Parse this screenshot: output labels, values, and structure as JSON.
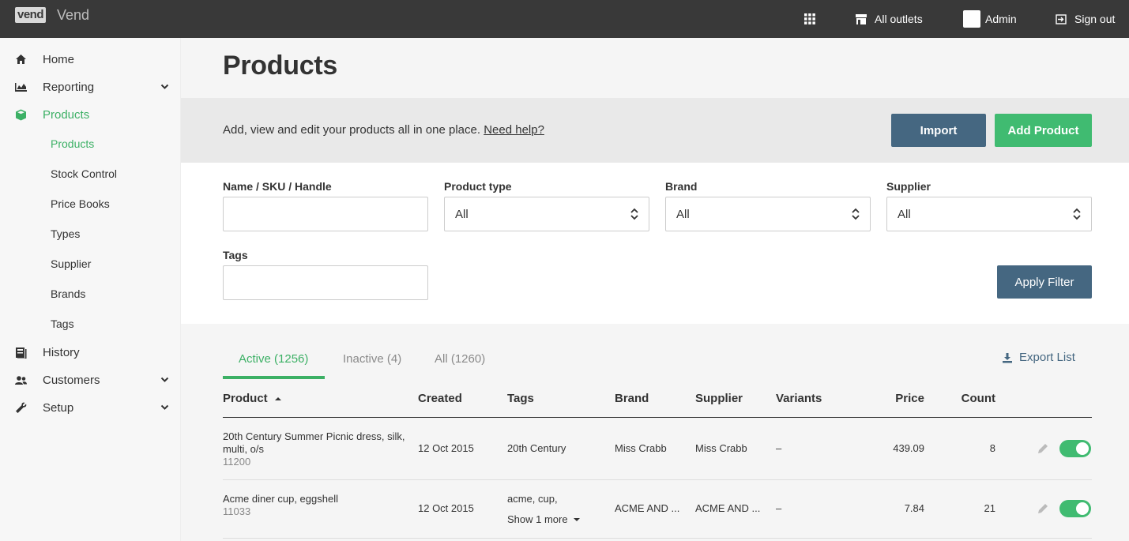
{
  "brand": {
    "logo_mark": "vend",
    "name": "Vend"
  },
  "topbar": {
    "apps_icon": "grid-icon",
    "outlets_label": "All outlets",
    "user_label": "Admin",
    "signout_label": "Sign out"
  },
  "sidebar": {
    "items": [
      {
        "label": "Home",
        "icon": "home-icon"
      },
      {
        "label": "Reporting",
        "icon": "chart-icon"
      },
      {
        "label": "Products",
        "icon": "box-icon"
      },
      {
        "label": "History",
        "icon": "book-icon"
      },
      {
        "label": "Customers",
        "icon": "people-icon"
      },
      {
        "label": "Setup",
        "icon": "wrench-icon"
      }
    ],
    "subitems": [
      "Products",
      "Stock Control",
      "Price Books",
      "Types",
      "Supplier",
      "Brands",
      "Tags"
    ]
  },
  "page": {
    "title": "Products",
    "info_text": "Add, view and edit your products all in one place.",
    "help_link": "Need help?",
    "import_label": "Import",
    "add_label": "Add Product"
  },
  "filters": {
    "name_label": "Name / SKU / Handle",
    "type_label": "Product type",
    "type_value": "All",
    "brand_label": "Brand",
    "brand_value": "All",
    "supplier_label": "Supplier",
    "supplier_value": "All",
    "tags_label": "Tags",
    "apply_label": "Apply Filter"
  },
  "tabs": {
    "active": "Active (1256)",
    "inactive": "Inactive (4)",
    "all": "All (1260)",
    "export": "Export List"
  },
  "table": {
    "headers": {
      "product": "Product",
      "created": "Created",
      "tags": "Tags",
      "brand": "Brand",
      "supplier": "Supplier",
      "variants": "Variants",
      "price": "Price",
      "count": "Count"
    },
    "rows": [
      {
        "name_line1": "20th Century Summer Picnic dress, silk,",
        "name_line2": "multi, o/s",
        "sku": "11200",
        "created": "12 Oct 2015",
        "tags": "20th Century",
        "tags_more": "",
        "brand": "Miss Crabb",
        "supplier": "Miss Crabb",
        "variants": "–",
        "price": "439.09",
        "count": "8"
      },
      {
        "name_line1": "Acme diner cup, eggshell",
        "name_line2": "",
        "sku": "11033",
        "created": "12 Oct 2015",
        "tags": "acme, cup,",
        "tags_more": "Show 1 more",
        "brand": "ACME AND ...",
        "supplier": "ACME AND ...",
        "variants": "–",
        "price": "7.84",
        "count": "21"
      }
    ]
  },
  "colors": {
    "topbar": "#393939",
    "accent_green": "#40bb71",
    "button_blue": "#456781"
  }
}
